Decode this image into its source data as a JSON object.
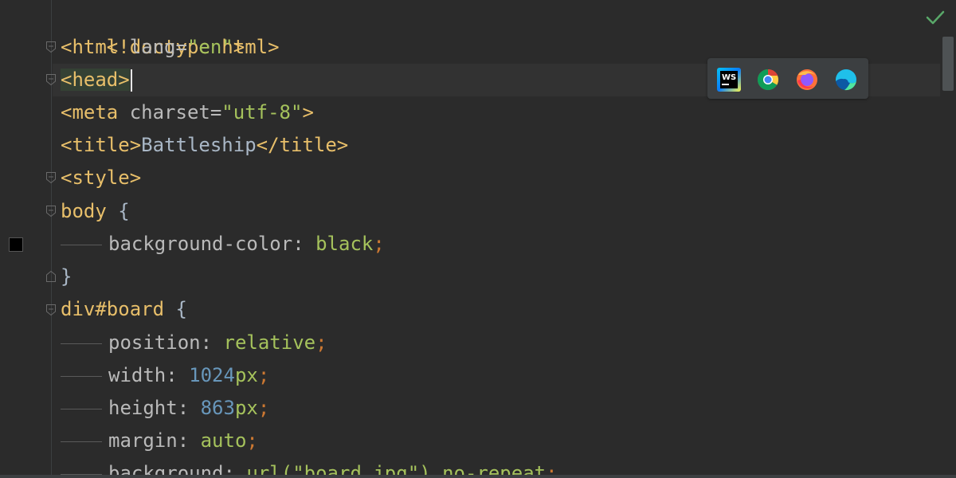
{
  "editor": {
    "lines": [
      {
        "t1": "<!doctype html>"
      },
      {
        "open": "<html",
        "attr": "lang=",
        "str": "\"en\"",
        "close": ">"
      },
      {
        "tag": "<head>"
      },
      {
        "open": "<meta",
        "attr": "charset=",
        "str": "\"utf-8\"",
        "close": ">"
      },
      {
        "open": "<title>",
        "text": "Battleship",
        "close": "</title>"
      },
      {
        "tag": "<style>"
      },
      {
        "sel": "body",
        "brace": "{"
      },
      {
        "prop": "background-color:",
        "val": "black",
        "semi": ";"
      },
      {
        "brace": "}"
      },
      {
        "sel": "div#board",
        "brace": "{"
      },
      {
        "prop": "position:",
        "val": "relative",
        "semi": ";"
      },
      {
        "prop": "width:",
        "num": "1024",
        "unit": "px",
        "semi": ";"
      },
      {
        "prop": "height:",
        "num": "863",
        "unit": "px",
        "semi": ";"
      },
      {
        "prop": "margin:",
        "val": "auto",
        "semi": ";"
      },
      {
        "prop": "background:",
        "func": "url(",
        "str": "\"board.jpg\"",
        "close": ")",
        "val": "no-repeat",
        "semi": ";"
      }
    ],
    "swatch_color": "#000000"
  },
  "browser_popup": {
    "icons": [
      "webstorm-icon",
      "chrome-icon",
      "firefox-icon",
      "edge-icon"
    ]
  },
  "status": {
    "icon": "check-icon",
    "color": "#59a869"
  }
}
